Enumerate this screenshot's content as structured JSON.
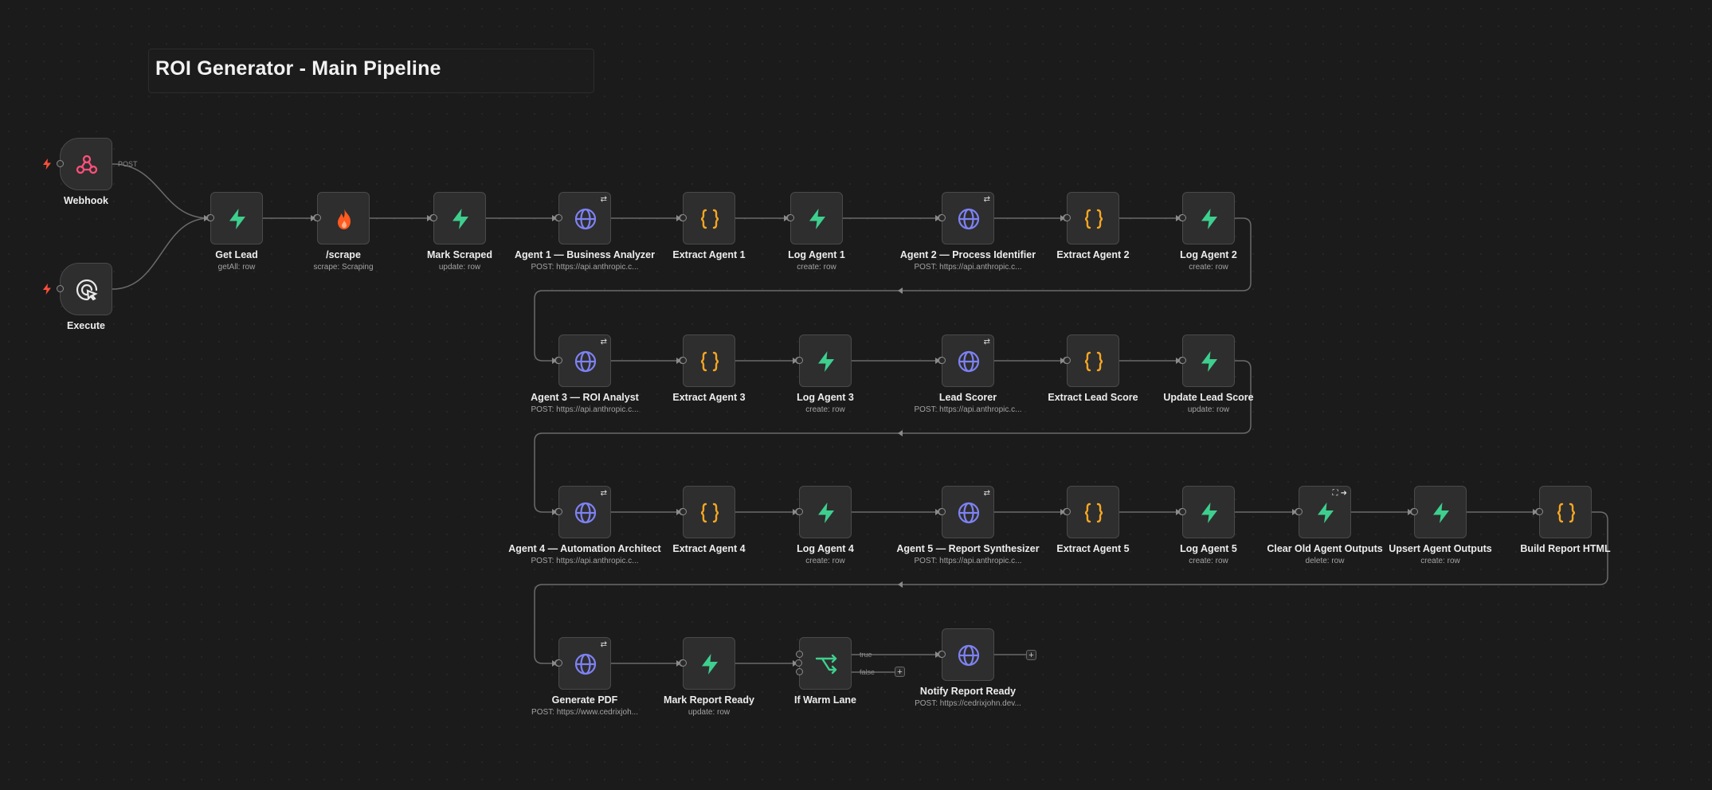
{
  "workflow": {
    "title": "ROI Generator - Main Pipeline"
  },
  "colors": {
    "supabase": "#3ecf8e",
    "http": "#7e82f3",
    "code": "#f5a623",
    "firecrawl": "#ff5a1f",
    "webhook": "#ff4f7a",
    "trigger_bolt": "#ff4f3a"
  },
  "nodes": [
    {
      "id": "webhook",
      "label": "Webhook",
      "sub": "",
      "icon": "webhook-icon"
    },
    {
      "id": "execute",
      "label": "Execute",
      "sub": "",
      "icon": "cursor-click-icon"
    },
    {
      "id": "get_lead",
      "label": "Get Lead",
      "sub": "getAll: row",
      "icon": "supabase-icon"
    },
    {
      "id": "scrape",
      "label": "/scrape",
      "sub": "scrape: Scraping",
      "icon": "firecrawl-icon"
    },
    {
      "id": "mark_scraped",
      "label": "Mark Scraped",
      "sub": "update: row",
      "icon": "supabase-icon"
    },
    {
      "id": "agent1",
      "label": "Agent 1 — Business Analyzer",
      "sub": "POST: https://api.anthropic.c...",
      "icon": "globe-icon"
    },
    {
      "id": "extract1",
      "label": "Extract Agent 1",
      "sub": "",
      "icon": "code-braces-icon"
    },
    {
      "id": "log1",
      "label": "Log Agent 1",
      "sub": "create: row",
      "icon": "supabase-icon"
    },
    {
      "id": "agent2",
      "label": "Agent 2 — Process Identifier",
      "sub": "POST: https://api.anthropic.c...",
      "icon": "globe-icon"
    },
    {
      "id": "extract2",
      "label": "Extract Agent 2",
      "sub": "",
      "icon": "code-braces-icon"
    },
    {
      "id": "log2",
      "label": "Log Agent 2",
      "sub": "create: row",
      "icon": "supabase-icon"
    },
    {
      "id": "agent3",
      "label": "Agent 3 — ROI Analyst",
      "sub": "POST: https://api.anthropic.c...",
      "icon": "globe-icon"
    },
    {
      "id": "extract3",
      "label": "Extract Agent 3",
      "sub": "",
      "icon": "code-braces-icon"
    },
    {
      "id": "log3",
      "label": "Log Agent 3",
      "sub": "create: row",
      "icon": "supabase-icon"
    },
    {
      "id": "lead_scorer",
      "label": "Lead Scorer",
      "sub": "POST: https://api.anthropic.c...",
      "icon": "globe-icon"
    },
    {
      "id": "extract_lead",
      "label": "Extract Lead Score",
      "sub": "",
      "icon": "code-braces-icon"
    },
    {
      "id": "update_lead",
      "label": "Update Lead Score",
      "sub": "update: row",
      "icon": "supabase-icon"
    },
    {
      "id": "agent4",
      "label": "Agent 4 — Automation Architect",
      "sub": "POST: https://api.anthropic.c...",
      "icon": "globe-icon"
    },
    {
      "id": "extract4",
      "label": "Extract Agent 4",
      "sub": "",
      "icon": "code-braces-icon"
    },
    {
      "id": "log4",
      "label": "Log Agent 4",
      "sub": "create: row",
      "icon": "supabase-icon"
    },
    {
      "id": "agent5",
      "label": "Agent 5 — Report Synthesizer",
      "sub": "POST: https://api.anthropic.c...",
      "icon": "globe-icon"
    },
    {
      "id": "extract5",
      "label": "Extract Agent 5",
      "sub": "",
      "icon": "code-braces-icon"
    },
    {
      "id": "log5",
      "label": "Log Agent 5",
      "sub": "create: row",
      "icon": "supabase-icon"
    },
    {
      "id": "clear_old",
      "label": "Clear Old Agent Outputs",
      "sub": "delete: row",
      "icon": "supabase-icon"
    },
    {
      "id": "upsert",
      "label": "Upsert Agent Outputs",
      "sub": "create: row",
      "icon": "supabase-icon"
    },
    {
      "id": "build_report",
      "label": "Build Report HTML",
      "sub": "",
      "icon": "code-braces-icon"
    },
    {
      "id": "gen_pdf",
      "label": "Generate PDF",
      "sub": "POST: https://www.cedrixjoh...",
      "icon": "globe-icon"
    },
    {
      "id": "mark_ready",
      "label": "Mark Report Ready",
      "sub": "update: row",
      "icon": "supabase-icon"
    },
    {
      "id": "if_warm",
      "label": "If Warm Lane",
      "sub": "",
      "icon": "branch-icon"
    },
    {
      "id": "notify",
      "label": "Notify Report Ready",
      "sub": "POST: https://cedrixjohn.dev...",
      "icon": "globe-icon"
    }
  ],
  "edge_labels": {
    "post": "POST",
    "true": "true",
    "false": "false"
  },
  "badges": {
    "retry": "⇄",
    "plus": "+"
  }
}
